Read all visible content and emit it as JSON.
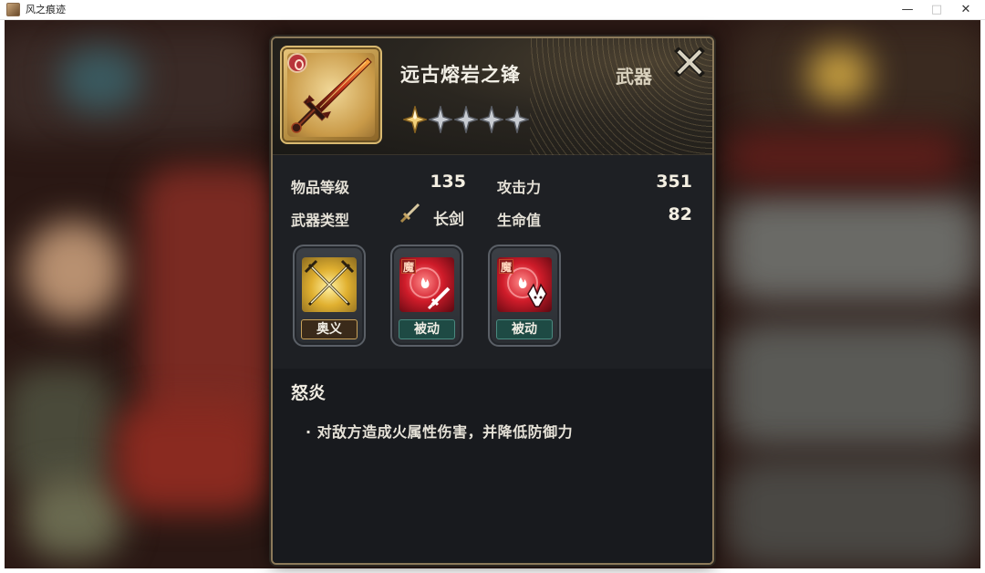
{
  "window": {
    "title": "风之痕迹",
    "app_icon": "game-portrait-icon",
    "controls": {
      "minimize": "—",
      "maximize": "□",
      "close": "✕"
    }
  },
  "item": {
    "name": "远古熔岩之锋",
    "category": "武器",
    "stars_filled": 1,
    "stars_total": 5,
    "icon": "lava-sword-icon",
    "element_badge": "fire-element-icon"
  },
  "stats": {
    "item_level_label": "物品等级",
    "item_level_value": "135",
    "weapon_type_label": "武器类型",
    "weapon_type_value": "长剑",
    "weapon_type_icon": "longsword-icon",
    "attack_label": "攻击力",
    "attack_value": "351",
    "hp_label": "生命值",
    "hp_value": "82"
  },
  "skills": [
    {
      "label": "奥义",
      "icon": "crossed-swords-icon",
      "tag": ""
    },
    {
      "label": "被动",
      "icon": "fire-sword-icon",
      "tag": "魔"
    },
    {
      "label": "被动",
      "icon": "fire-fox-icon",
      "tag": "魔"
    }
  ],
  "description": {
    "title": "怒炎",
    "text": "· 对敌方造成火属性伤害，并降低防御力"
  },
  "colors": {
    "panel_border": "#8c7a5a",
    "panel_bg": "#1e2024",
    "gold_frame": "#d9b970",
    "passive_label": "#1e4a44",
    "fire_red": "#c8202c"
  }
}
